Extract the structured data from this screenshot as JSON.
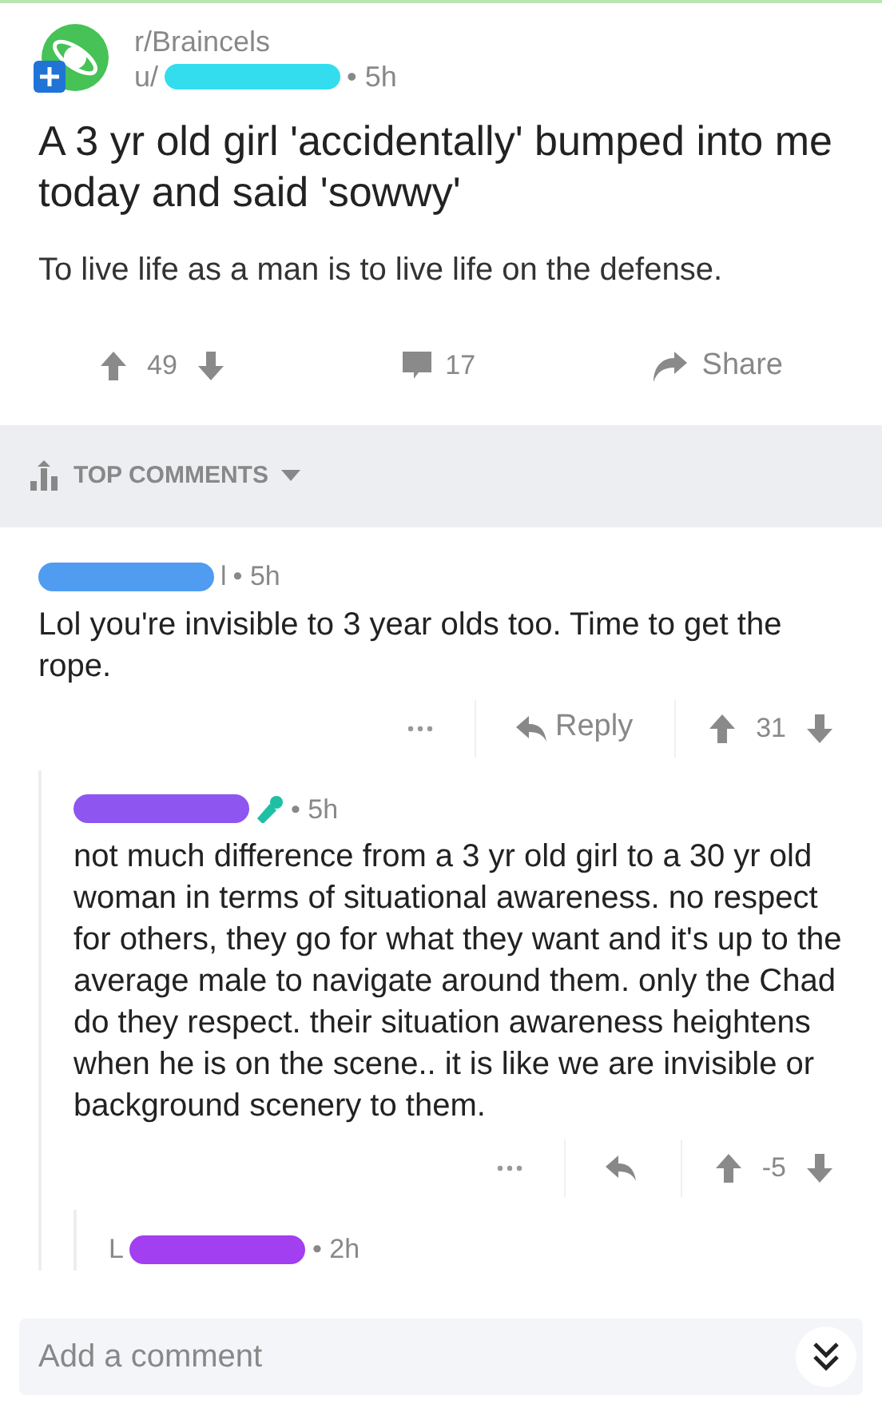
{
  "post": {
    "subreddit": "r/Braincels",
    "author_prefix": "u/",
    "color": "#33ddee",
    "time": "• 5h",
    "title": "A 3 yr old girl 'accidentally' bumped into me today and said 'sowwy'",
    "body": "To live life as a man is to live life on the defense.",
    "score": "49",
    "comment_count": "17",
    "share_label": "Share"
  },
  "sort": {
    "label": "TOP COMMENTS"
  },
  "comments": [
    {
      "color": "#4f9cf0",
      "author_suffix": "l",
      "time": "• 5h",
      "body": "Lol you're invisible to 3 year olds too. Time to get the rope.",
      "reply_label": "Reply",
      "score": "31",
      "children": [
        {
          "color": "#8f55f0",
          "mic_flair": true,
          "time": "• 5h",
          "body": "not much difference from a 3 yr old girl to a 30 yr old woman in terms of situational awareness. no respect for others, they go for what they want and it's up to the average male to navigate around them. only the Chad do they respect. their situation awareness heightens when he is on the scene.. it is like we are invisible or background scenery to them.",
          "score": "-5",
          "children": [
            {
              "author_prefix": "L",
              "color": "#a23ff0",
              "time": "• 2h"
            }
          ]
        }
      ]
    }
  ],
  "composer": {
    "placeholder": "Add a comment"
  }
}
